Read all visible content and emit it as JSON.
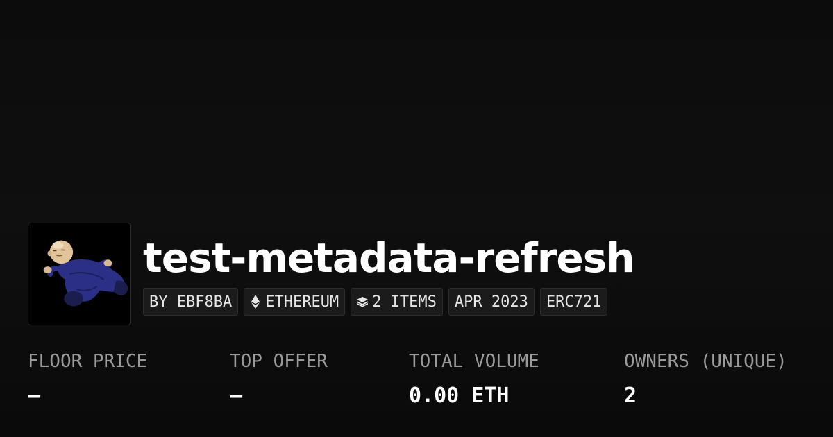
{
  "collection": {
    "title": "test-metadata-refresh",
    "avatar_icon": "sleeping-character-avatar"
  },
  "chips": {
    "creator": "BY EBF8BA",
    "chain": "ETHEREUM",
    "chain_icon": "ethereum-icon",
    "items": "2 ITEMS",
    "items_icon": "layers-icon",
    "date": "APR 2023",
    "standard": "ERC721"
  },
  "stats": {
    "floor_price": {
      "label": "FLOOR PRICE",
      "value": "–"
    },
    "top_offer": {
      "label": "TOP OFFER",
      "value": "–"
    },
    "total_volume": {
      "label": "TOTAL VOLUME",
      "value": "0.00 ETH"
    },
    "owners": {
      "label": "OWNERS (UNIQUE)",
      "value": "2"
    }
  },
  "colors": {
    "background": "#0e0e0e",
    "chip_background": "#1b1b1b",
    "label_gray": "#9a9a9a",
    "text_white": "#ffffff"
  }
}
